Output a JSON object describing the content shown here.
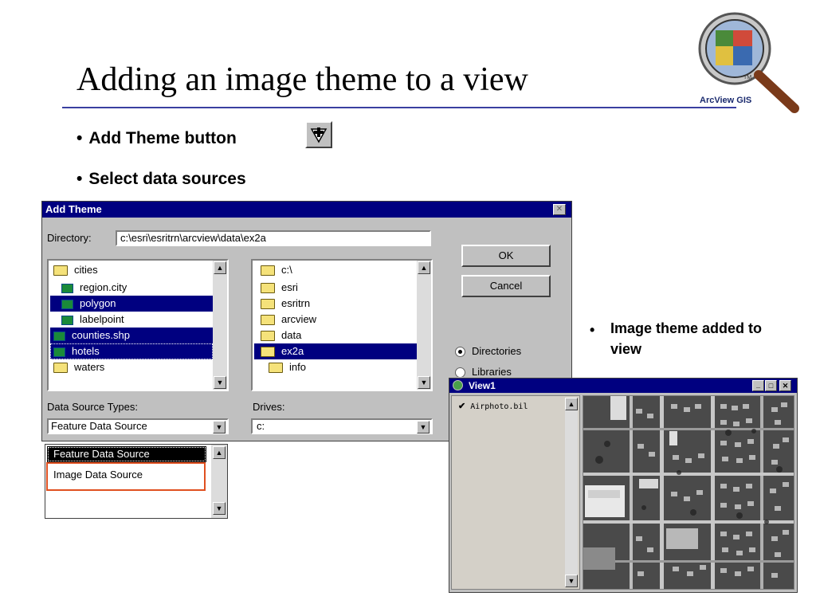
{
  "slide": {
    "title": "Adding an image theme to a view",
    "bullets": [
      "Add Theme button",
      "Select data sources"
    ],
    "side_bullet_line1": "Image theme added to",
    "side_bullet_line2": "view",
    "bullet_char": "•"
  },
  "logo": {
    "text": "ArcView GIS",
    "tm": "TM"
  },
  "add_theme_dialog": {
    "title": "Add Theme",
    "directory_label": "Directory:",
    "directory_value": "c:\\esri\\esritrn\\arcview\\data\\ex2a",
    "files": [
      {
        "label": "cities",
        "icon": "folder-open-icon",
        "selected": false
      },
      {
        "label": "region.city",
        "icon": "image-theme-icon",
        "selected": false
      },
      {
        "label": "polygon",
        "icon": "image-theme-icon",
        "selected": true
      },
      {
        "label": "labelpoint",
        "icon": "image-theme-icon",
        "selected": false
      },
      {
        "label": "counties.shp",
        "icon": "image-theme-icon",
        "selected": true
      },
      {
        "label": "hotels",
        "icon": "image-theme-icon",
        "selected": true
      },
      {
        "label": "waters",
        "icon": "folder-icon",
        "selected": false
      }
    ],
    "directories": [
      {
        "label": "c:\\",
        "selected": false
      },
      {
        "label": "esri",
        "selected": false
      },
      {
        "label": "esritrn",
        "selected": false
      },
      {
        "label": "arcview",
        "selected": false
      },
      {
        "label": "data",
        "selected": false
      },
      {
        "label": "ex2a",
        "selected": true
      },
      {
        "label": "info",
        "selected": false
      }
    ],
    "ok_label": "OK",
    "cancel_label": "Cancel",
    "radio_directories": "Directories",
    "radio_libraries": "Libraries",
    "data_source_types_label": "Data Source Types:",
    "data_source_value": "Feature Data Source",
    "drives_label": "Drives:",
    "drives_value": "c:"
  },
  "dropdown_options": [
    "Feature Data Source",
    "Image Data Source"
  ],
  "view_window": {
    "title": "View1",
    "theme_label": "Airphoto.bil",
    "theme_checked": true
  },
  "colors": {
    "titlebar": "#000080",
    "selection": "#000080",
    "highlight_box": "#e05020",
    "title_rule": "#3a3fa0"
  }
}
